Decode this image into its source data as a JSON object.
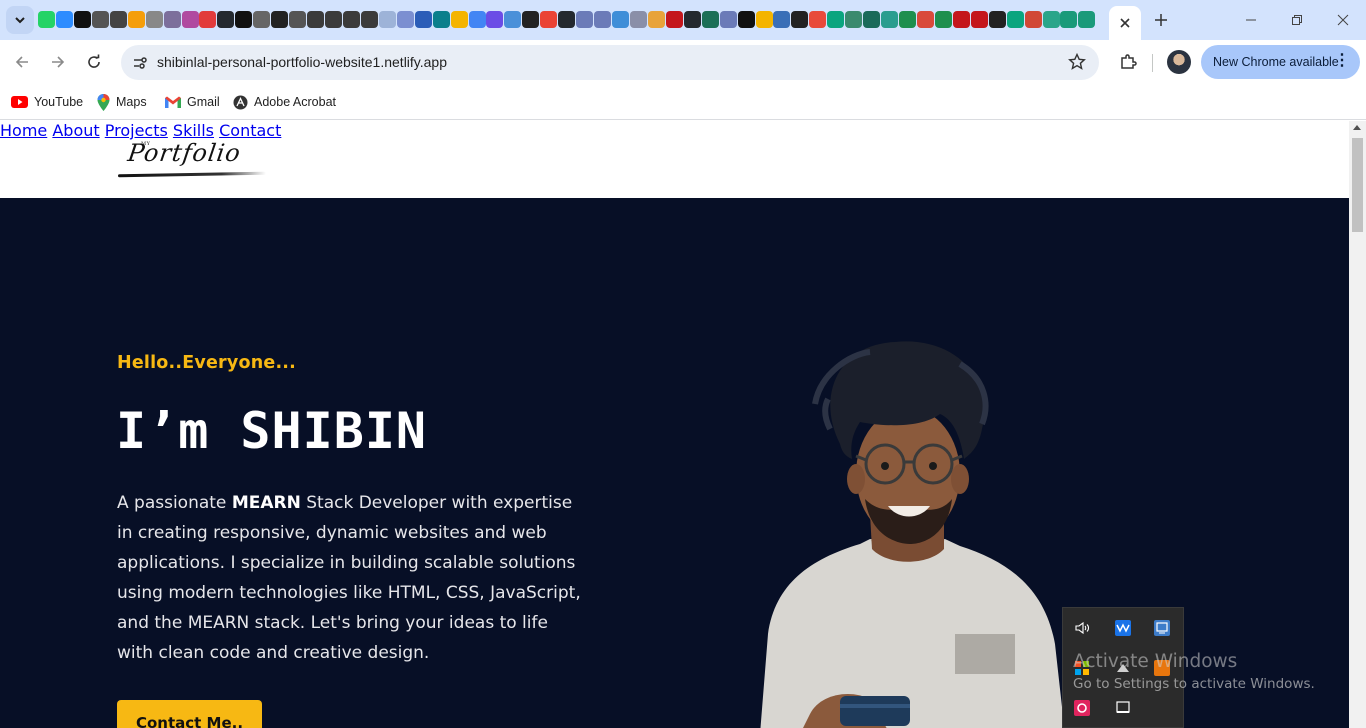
{
  "browser": {
    "url": "shibinlal-personal-portfolio-website1.netlify.app",
    "update_button": "New Chrome available",
    "pinned_tab_icons": [
      "whatsapp-icon",
      "zoom-icon",
      "app-icon",
      "game-icon",
      "game-icon",
      "squarespace-icon",
      "notion-icon",
      "app-icon",
      "app-icon",
      "s-app-icon",
      "github-icon",
      "notion-icon",
      "app-icon",
      "m-app-icon",
      "game-icon",
      "openai-icon",
      "openai-icon",
      "openai-icon",
      "openai-icon",
      "app-icon",
      "app-icon",
      "app-icon",
      "app-icon",
      "maps-icon",
      "google-icon",
      "b-app-icon",
      "app-icon",
      "sigma-icon",
      "gmail-icon",
      "github-icon",
      "app-icon",
      "app-icon",
      "app-icon",
      "app-icon",
      "app-icon",
      "notion-icon",
      "github-icon",
      "app-icon",
      "app-icon",
      "app-icon",
      "app-icon",
      "app-icon",
      "l-app-icon",
      "app-icon",
      "app-icon",
      "app-icon",
      "app-icon",
      "app-icon",
      "app-icon",
      "app-icon",
      "app-icon",
      "notion-icon",
      "notion-icon",
      "app-icon",
      "app-icon",
      "app-icon",
      "gmail-icon",
      "app-icon",
      "app-icon"
    ],
    "pinned_tab_colors": [
      "#25d366",
      "#2d8cff",
      "#111111",
      "#555555",
      "#444444",
      "#f59e0b",
      "#888888",
      "#7c6f9c",
      "#b04aa0",
      "#e23b3b",
      "#24292f",
      "#111111",
      "#666666",
      "#222222",
      "#555555",
      "#3b3b3b",
      "#3b3b3b",
      "#3b3b3b",
      "#3b3b3b",
      "#9db3d8",
      "#7b8fd1",
      "#2b5db8",
      "#0b7f8c",
      "#f4b400",
      "#4285f4",
      "#6b4de6",
      "#4a90d9",
      "#222222",
      "#ea4335",
      "#24292f",
      "#6b7bb8",
      "#6b7bb8",
      "#3f8ed8",
      "#8a8fa8",
      "#e8a33a",
      "#c4161c",
      "#24292f",
      "#1b6f57",
      "#6b7bb8",
      "#111111",
      "#f4b400",
      "#3a6fb7",
      "#222222",
      "#e84a3b",
      "#0aa57f",
      "#3a8a6e",
      "#1a6a5a",
      "#2a9d8f",
      "#1e8f4e",
      "#d94a3b",
      "#1e8f4e",
      "#c4161c",
      "#c4161c",
      "#222222",
      "#0aa57f",
      "#d14836",
      "#2aa58a",
      "#1a9a7a",
      "#1a9a7a"
    ]
  },
  "bookmarks": [
    {
      "label": "YouTube",
      "icon": "youtube-icon"
    },
    {
      "label": "Maps",
      "icon": "maps-icon"
    },
    {
      "label": "Gmail",
      "icon": "gmail-icon"
    },
    {
      "label": "Adobe Acrobat",
      "icon": "adobe-acrobat-icon"
    }
  ],
  "site": {
    "logo": {
      "text": "Portfolio",
      "small": "MY"
    },
    "nav": [
      "Home",
      "About",
      "Projects",
      "Skills",
      "Contact"
    ],
    "hero": {
      "greeting": "Hello..Everyone...",
      "name": "I’m SHIBIN",
      "desc_before": "A passionate ",
      "desc_em": "MEARN",
      "desc_after": " Stack Developer with expertise in creating responsive, dynamic websites and web applications. I specialize in building scalable solutions using modern technologies like HTML, CSS, JavaScript, and the MEARN stack. Let's bring your ideas to life with clean code and creative design.",
      "cta": "Contact Me.."
    },
    "colors": {
      "accent": "#f7b813",
      "hero_bg": "#070f26"
    }
  },
  "os": {
    "watermark_title": "Activate Windows",
    "watermark_sub": "Go to Settings to activate Windows.",
    "tray_icons": [
      "volume-icon",
      "audio-app-icon",
      "network-app-icon",
      "security-icon",
      "app-icon",
      "app-icon",
      "app-icon",
      "display-icon"
    ]
  }
}
